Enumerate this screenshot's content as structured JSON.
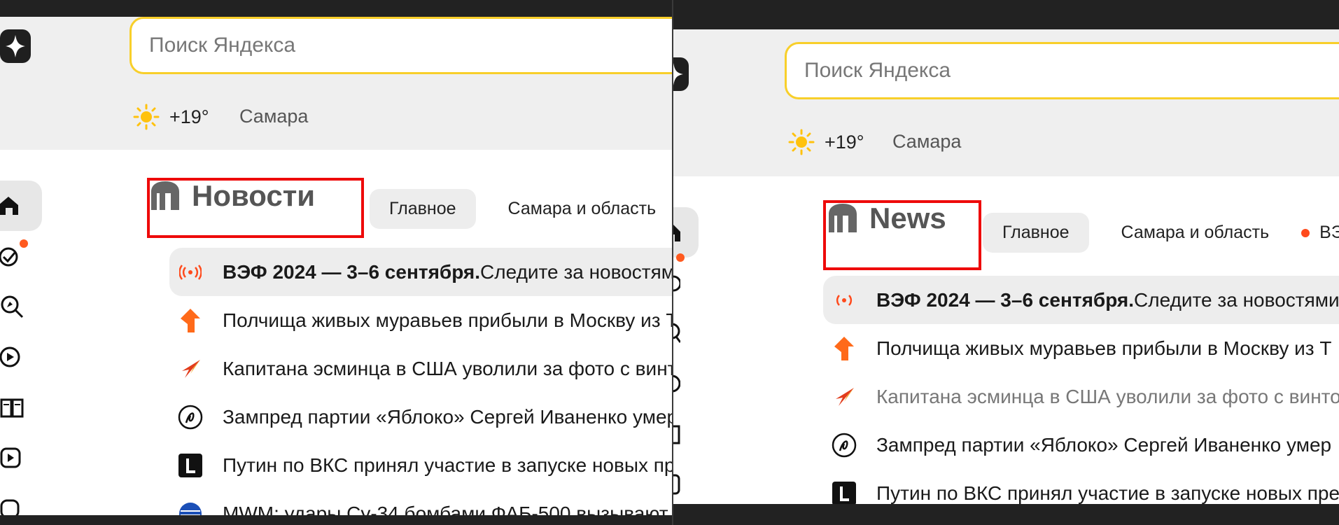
{
  "search": {
    "placeholder": "Поиск Яндекса"
  },
  "weather": {
    "temperature": "+19°",
    "city": "Самара"
  },
  "news": {
    "panel1_title": "Новости",
    "panel2_title": "News",
    "tabs": [
      "Главное",
      "Самара и область",
      "ВЭФ"
    ],
    "items": [
      {
        "bold": "ВЭФ 2024 — 3–6 сентября.",
        "text": " Следите за новостями"
      },
      {
        "bold": "",
        "text": "Полчища живых муравьев прибыли в Москву из Т"
      },
      {
        "bold": "",
        "text": "Капитана эсминца в США уволили за фото с винто"
      },
      {
        "bold": "",
        "text": "Зампред партии «Яблоко» Сергей Иваненко умер"
      },
      {
        "bold": "",
        "text": "Путин по ВКС принял участие в запуске новых пре"
      },
      {
        "bold": "",
        "text": "MWM: удары Су-34 бомбами ФАБ-500 вызывают"
      }
    ]
  },
  "colors": {
    "highlight_box": "#ee0a0a",
    "search_border": "#f8cf2a",
    "notification": "#ff5a1f"
  }
}
